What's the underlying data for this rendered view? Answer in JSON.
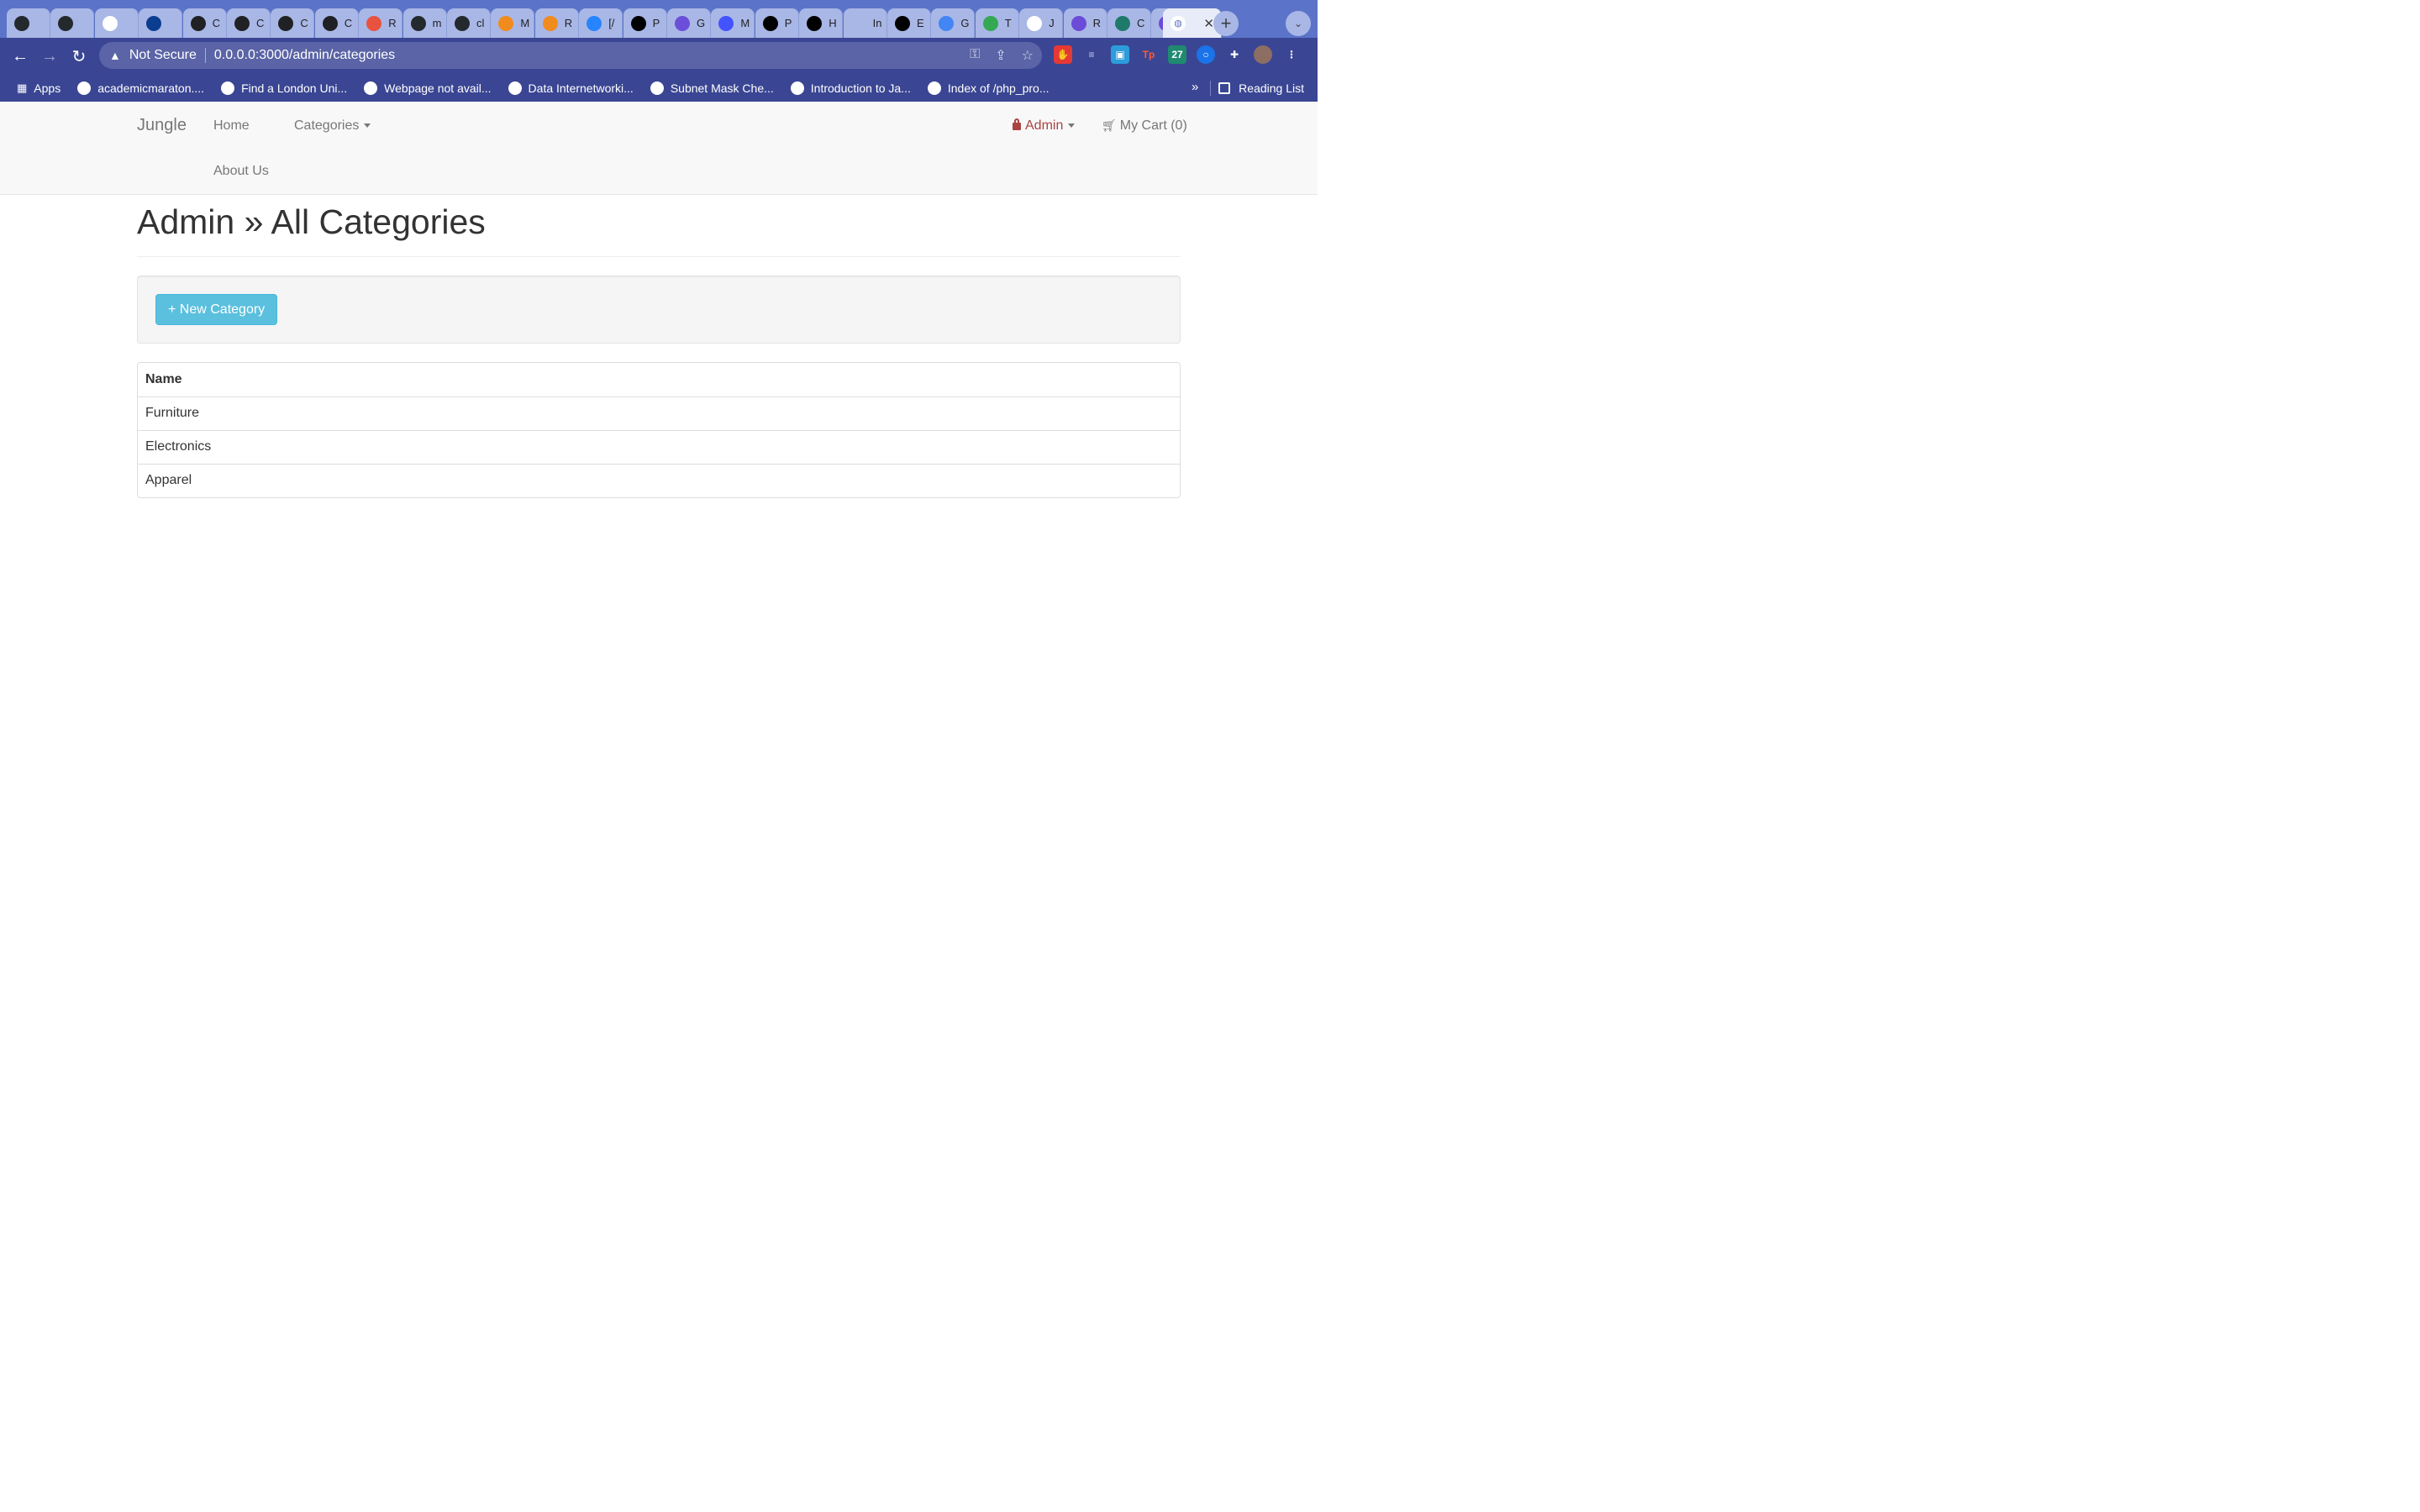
{
  "browser": {
    "tabs": [
      {
        "letter": "",
        "color": "#24292e"
      },
      {
        "letter": "",
        "color": "#24292e"
      },
      {
        "letter": "",
        "color": "#ffffff"
      },
      {
        "letter": "",
        "color": "#0b3d91"
      },
      {
        "letter": "C",
        "color": "#202124"
      },
      {
        "letter": "C",
        "color": "#202124"
      },
      {
        "letter": "C",
        "color": "#202124"
      },
      {
        "letter": "C",
        "color": "#202124"
      },
      {
        "letter": "R",
        "color": "#e8533f"
      },
      {
        "letter": "m",
        "color": "#24292e"
      },
      {
        "letter": "cl",
        "color": "#24292e"
      },
      {
        "letter": "M",
        "color": "#f08b1d"
      },
      {
        "letter": "R",
        "color": "#f08b1d"
      },
      {
        "letter": "[/",
        "color": "#2684ff"
      },
      {
        "letter": "P",
        "color": "#000000"
      },
      {
        "letter": "G",
        "color": "#6c4fd8"
      },
      {
        "letter": "M",
        "color": "#4353ff"
      },
      {
        "letter": "P",
        "color": "#000000"
      },
      {
        "letter": "H",
        "color": "#000000"
      },
      {
        "letter": "In",
        "color": "#a9b7e6"
      },
      {
        "letter": "E",
        "color": "#000000"
      },
      {
        "letter": "G",
        "color": "#4285f4"
      },
      {
        "letter": "T",
        "color": "#34a853"
      },
      {
        "letter": "J",
        "color": "#ffffff"
      },
      {
        "letter": "R",
        "color": "#6b4bd8"
      },
      {
        "letter": "C",
        "color": "#1f7a6b"
      },
      {
        "letter": "R",
        "color": "#6b4bd8"
      }
    ],
    "address": {
      "security": "Not Secure",
      "url": "0.0.0.0:3000/admin/categories"
    },
    "bookmarks": {
      "apps": "Apps",
      "items": [
        "academicmaraton....",
        "Find a London Uni...",
        "Webpage not avail...",
        "Data Internetworki...",
        "Subnet Mask Che...",
        "Introduction to Ja...",
        "Index of /php_pro..."
      ],
      "overflow": "»",
      "reading_list": "Reading List"
    }
  },
  "nav": {
    "brand": "Jungle",
    "home": "Home",
    "categories": "Categories",
    "about": "About Us",
    "admin": "Admin",
    "cart": "My Cart (0)"
  },
  "page": {
    "title": "Admin » All Categories",
    "new_button": "+ New Category"
  },
  "table": {
    "header": "Name",
    "rows": [
      "Furniture",
      "Electronics",
      "Apparel"
    ]
  },
  "colors": {
    "accent_info": "#5bc0de",
    "admin_red": "#a94442",
    "tab_bar": "#5b74c9",
    "toolbar": "#3a4693"
  }
}
